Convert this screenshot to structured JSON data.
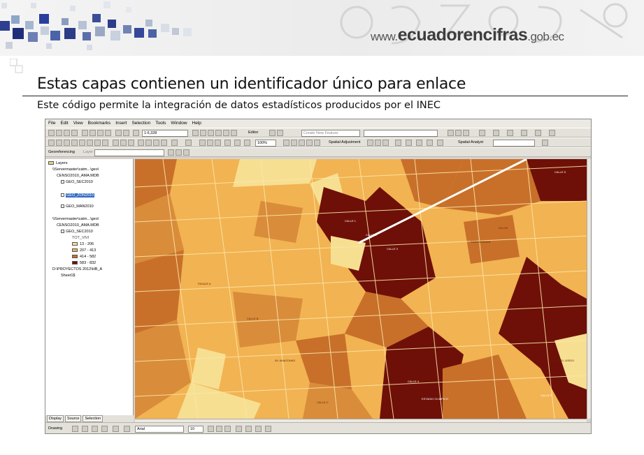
{
  "banner": {
    "site_www": "www.",
    "site_name": "ecuadorencifras",
    "site_tld": ".gob.ec"
  },
  "slide": {
    "title": "Estas capas contienen un identificador único para enlace",
    "subtitle": "Este código permite la integración de datos estadísticos producidos por el INEC"
  },
  "app": {
    "menu": [
      "File",
      "Edit",
      "View",
      "Bookmarks",
      "Insert",
      "Selection",
      "Tools",
      "Window",
      "Help"
    ],
    "scale": "1:6,328",
    "editor_label": "Editor",
    "create_feature": "Create New Feature",
    "spatial_adjustment": "Spatial Adjustment",
    "spatial_analyst": "Spatial Analyst",
    "georeferencing": "Georeferencing",
    "layer_label": "Layer:",
    "zoom": "100%",
    "drawing": "Drawing",
    "font": "Arial",
    "font_size": "10"
  },
  "toc": {
    "root": "Layers",
    "items": [
      "\\\\Servermaster\\catm...\\geo\\",
      "CENSO2010_AMA.MDB",
      "GEO_SEC2010",
      "GEO_ZON2010",
      "GEO_MAN2010",
      "\\\\Servermaster\\catm...\\geo\\",
      "CENSO2010_AMA.MDB",
      "GEO_SEC2010",
      "TOT_VIVI"
    ],
    "legend": [
      {
        "label": "13 - 206",
        "color": "#f7df92"
      },
      {
        "label": "207 - 413",
        "color": "#f2b352"
      },
      {
        "label": "414 - 582",
        "color": "#c8702a"
      },
      {
        "label": "583 - 832",
        "color": "#6e1008"
      }
    ],
    "extra_path": "D:\\PROYECTOS 2012\\HB_A",
    "sheet": "Sheet1$",
    "tabs": [
      "Display",
      "Source",
      "Selection"
    ]
  },
  "map_labels": [
    "CALLE 1",
    "CALLE 2",
    "CALLE 3",
    "CALLE 4",
    "CALLE 5",
    "CASA MONJAS",
    "ULLOA",
    "AV. AMAZONAS",
    "CALLE B",
    "PASAJE A",
    "MOTEL LEEDS",
    "CALLE E",
    "ESTADIO OLIMPICO",
    "CALLE C"
  ]
}
